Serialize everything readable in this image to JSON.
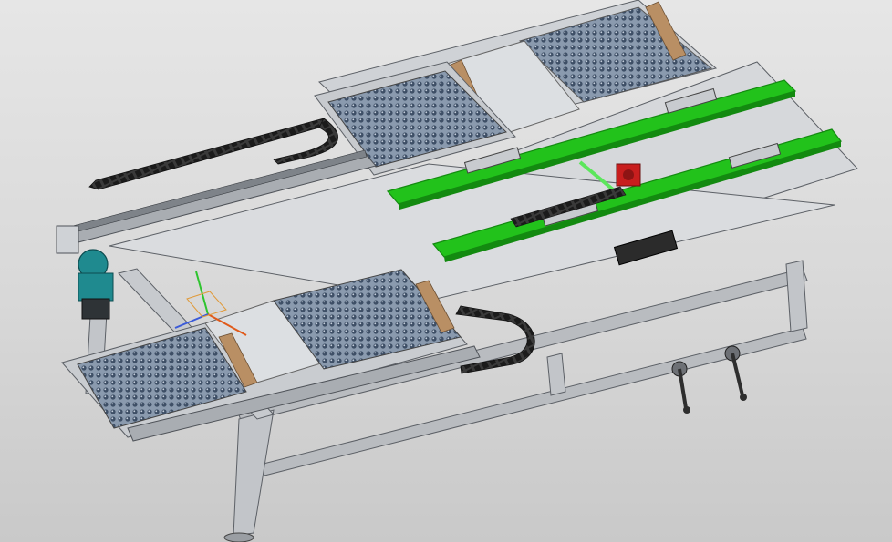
{
  "viewport": {
    "background_top": "#e6e6e6",
    "background_bottom": "#c9c9c9"
  },
  "colors": {
    "frame": "#b9bcc0",
    "frame_edge": "#5c6066",
    "panel": "#d9dbde",
    "belt_green": "#22c21b",
    "belt_green_dark": "#138a10",
    "roller_grid": "#5f7189",
    "motor_teal": "#1f8a8f",
    "motor_red": "#c81e1e",
    "guide_tan": "#b98f64",
    "cable_chain": "#2b2b2b",
    "handle_dark": "#2e2e2e",
    "axis_x": "#e05a1a",
    "axis_y": "#2ec42e",
    "axis_z": "#3a5ad8"
  },
  "icons": {
    "triad": "coordinate-triad-icon"
  }
}
